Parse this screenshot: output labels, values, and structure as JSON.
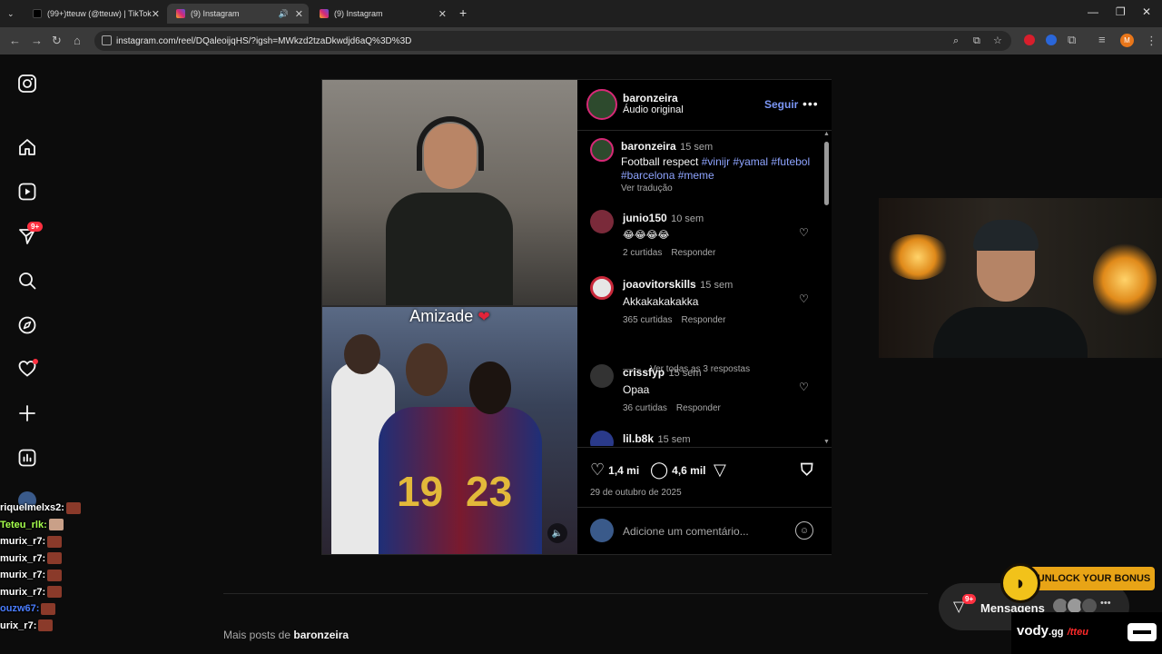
{
  "browser": {
    "tabs": [
      {
        "title": "(99+)tteuw (@tteuw) | TikTok",
        "active": false
      },
      {
        "title": "(9) Instagram",
        "active": true
      },
      {
        "title": "(9) Instagram",
        "active": false
      }
    ],
    "url": "instagram.com/reel/DQaleoijqHS/?igsh=MWkzd2tzaDkwdjd6aQ%3D%3D",
    "profile_initial": "M"
  },
  "sidebar": {
    "notifications_badge": "9+"
  },
  "chat": [
    {
      "user": "riquelmelxs2:",
      "color": "#ffffff"
    },
    {
      "user": "Teteu_rlk:",
      "color": "#a6ff4d"
    },
    {
      "user": "murix_r7:",
      "color": "#ffffff"
    },
    {
      "user": "murix_r7:",
      "color": "#ffffff"
    },
    {
      "user": "murix_r7:",
      "color": "#ffffff"
    },
    {
      "user": "murix_r7:",
      "color": "#ffffff"
    },
    {
      "user": "ouzw67:",
      "color": "#4a7dff"
    },
    {
      "user": "urix_r7:",
      "color": "#ffffff"
    }
  ],
  "post": {
    "caption_overlay": "Amizade",
    "author": "baronzeira",
    "audio": "Áudio original",
    "follow_label": "Seguir",
    "more": "•••",
    "description": {
      "user": "baronzeira",
      "time": "15 sem",
      "text": "Football respect",
      "tags_line1": "#vinijr #yamal #futebol",
      "tags_line2": "#barcelona #meme",
      "translate": "Ver tradução"
    },
    "comments": [
      {
        "user": "junio150",
        "time": "10 sem",
        "text": "😂😂😂😂",
        "likes": "2 curtidas",
        "reply": "Responder"
      },
      {
        "user": "joaovitorskills",
        "time": "15 sem",
        "text": "Akkakakakakka",
        "likes": "365 curtidas",
        "reply": "Responder"
      },
      {
        "user": "crissfyp",
        "time": "15 sem",
        "text": "Opaa",
        "likes": "36 curtidas",
        "reply": "Responder"
      },
      {
        "user": "lil.b8k",
        "time": "15 sem"
      }
    ],
    "view_replies": "Ver todas as 3 respostas",
    "like_count": "1,4 mi",
    "comment_count": "4,6 mil",
    "date": "29 de outubro de 2025",
    "add_comment_placeholder": "Adicione um comentário..."
  },
  "more_posts": {
    "prefix": "Mais posts de",
    "user": "baronzeira"
  },
  "overlay": {
    "bonus": "UNLOCK YOUR BONUS",
    "messages": "Mensagens",
    "messages_badge": "9+",
    "vody_brand": "vody",
    "vody_domain": ".gg",
    "vody_handle": "/tteu"
  }
}
